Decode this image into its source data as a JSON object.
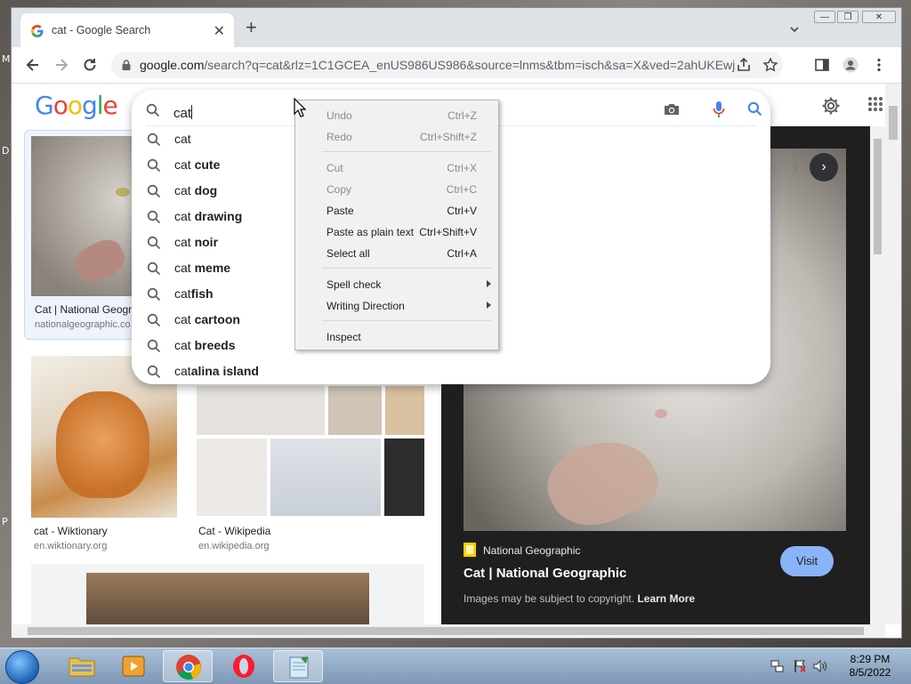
{
  "desktop": {
    "edge_labels": [
      "M",
      "D",
      "P"
    ]
  },
  "window": {
    "controls": {
      "minimize": "—",
      "restore": "❐",
      "close": "✕"
    }
  },
  "tab": {
    "title": "cat - Google Search",
    "close": "✕"
  },
  "newtab": "+",
  "toolbar": {
    "url_host": "google.com",
    "url_path": "/search?q=cat&rlz=1C1GCEA_enUS986US986&source=lnms&tbm=isch&sa=X&ved=2ahUKEwj..."
  },
  "logo": "Google",
  "search": {
    "query": "cat",
    "suggestions": [
      {
        "prefix": "cat",
        "bold": ""
      },
      {
        "prefix": "cat ",
        "bold": "cute"
      },
      {
        "prefix": "cat ",
        "bold": "dog"
      },
      {
        "prefix": "cat ",
        "bold": "drawing"
      },
      {
        "prefix": "cat ",
        "bold": "noir"
      },
      {
        "prefix": "cat ",
        "bold": "meme"
      },
      {
        "prefix": "cat",
        "bold": "fish"
      },
      {
        "prefix": "cat ",
        "bold": "cartoon"
      },
      {
        "prefix": "cat ",
        "bold": "breeds"
      },
      {
        "prefix": "cat",
        "bold": "alina island"
      }
    ]
  },
  "context_menu": {
    "items": [
      {
        "label": "Undo",
        "shortcut": "Ctrl+Z",
        "disabled": true
      },
      {
        "label": "Redo",
        "shortcut": "Ctrl+Shift+Z",
        "disabled": true
      },
      {
        "label": "Cut",
        "shortcut": "Ctrl+X",
        "disabled": true
      },
      {
        "label": "Copy",
        "shortcut": "Ctrl+C",
        "disabled": true
      },
      {
        "label": "Paste",
        "shortcut": "Ctrl+V",
        "disabled": false
      },
      {
        "label": "Paste as plain text",
        "shortcut": "Ctrl+Shift+V",
        "disabled": false
      },
      {
        "label": "Select all",
        "shortcut": "Ctrl+A",
        "disabled": false
      },
      {
        "label": "Spell check",
        "shortcut": "",
        "submenu": true
      },
      {
        "label": "Writing Direction",
        "shortcut": "",
        "submenu": true
      },
      {
        "label": "Inspect",
        "shortcut": ""
      }
    ]
  },
  "results": [
    {
      "title": "Cat | National Geogr",
      "source": "nationalgeographic.co"
    },
    {
      "title": "cat - Wiktionary",
      "source": "en.wiktionary.org"
    },
    {
      "title": "Cat - Wikipedia",
      "source": "en.wikipedia.org"
    }
  ],
  "preview": {
    "source_name": "National Geographic",
    "title": "Cat | National Geographic",
    "visit_label": "Visit",
    "copyright_text": "Images may be subject to copyright.",
    "learn_more": "Learn More",
    "nav_prev": "‹",
    "nav_next": "›"
  },
  "taskbar": {
    "time": "8:29 PM",
    "date": "8/5/2022"
  },
  "colors": {
    "google_blue": "#4285f4",
    "google_red": "#ea4335",
    "google_yellow": "#fbbc05",
    "google_green": "#34a853",
    "visit_button": "#8ab4f8"
  }
}
